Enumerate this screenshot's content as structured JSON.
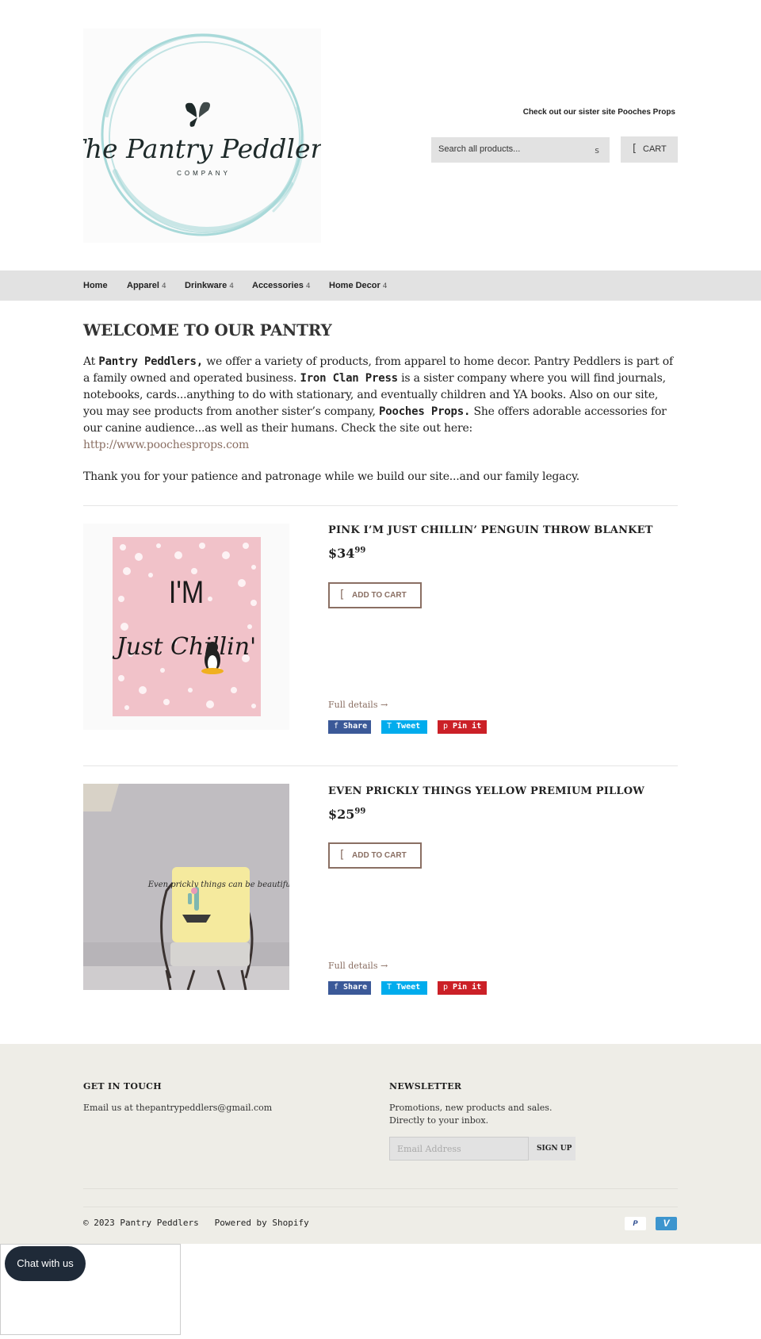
{
  "header": {
    "logo_text": "The Pantry Peddlers",
    "logo_subtext": "COMPANY",
    "sister_link": "Check out our sister site Pooches Props",
    "search_placeholder": "Search all products...",
    "search_icon_glyph": "s",
    "cart_icon_glyph": "[",
    "cart_label": "CART"
  },
  "nav": {
    "items": [
      {
        "label": "Home"
      },
      {
        "label": "Apparel",
        "caret": "4"
      },
      {
        "label": "Drinkware",
        "caret": "4"
      },
      {
        "label": "Accessories",
        "caret": "4"
      },
      {
        "label": "Home Decor",
        "caret": "4"
      }
    ]
  },
  "welcome": {
    "title": "WELCOME TO OUR PANTRY",
    "p1_a": "At ",
    "p1_b": "Pantry Peddlers,",
    "p1_c": "  we offer a variety of products, from apparel to home decor. Pantry Peddlers is part of a family owned and operated business. ",
    "p1_d": "Iron Clan Press",
    "p1_e": "  is a sister company where you will find journals, notebooks, cards...anything to do with stationary, and eventually children and YA books. Also on our site, you may see products from another sister’s company, ",
    "p1_f": "Pooches Props.",
    "p1_g": "  She  offers adorable accessories for our canine audience...as well as their humans. Check the site out here: ",
    "p1_link": "http://www.poochesprops.com",
    "thanks": "Thank you for your patience and patronage while we build our site...and our family legacy."
  },
  "products": [
    {
      "title": "PINK I’M JUST CHILLIN’ PENGUIN THROW BLANKET",
      "price_main": "$34",
      "price_cents": "99",
      "image_text_1": "I'M",
      "image_text_2": "Just Chillin'",
      "add_to_cart": "ADD TO CART",
      "full_details": "Full details →"
    },
    {
      "title": "EVEN PRICKLY THINGS YELLOW PREMIUM PILLOW",
      "price_main": "$25",
      "price_cents": "99",
      "image_text_1": "Even prickly things can be beautiful.",
      "add_to_cart": "ADD TO CART",
      "full_details": "Full details →"
    }
  ],
  "social": {
    "share_icon": "f",
    "share": "Share",
    "tweet_icon": "T",
    "tweet": "Tweet",
    "pin_icon": "p",
    "pin": "Pin it"
  },
  "footer": {
    "contact_heading": "GET IN TOUCH",
    "contact_text": "Email us at thepantrypeddlers@gmail.com",
    "newsletter_heading": "NEWSLETTER",
    "newsletter_text_1": "Promotions, new products and sales.",
    "newsletter_text_2": "Directly to your inbox.",
    "email_placeholder": "Email Address",
    "signup": "SIGN UP",
    "copyright": "© 2023 Pantry Peddlers",
    "powered": "Powered by Shopify",
    "payment_paypal": "P",
    "payment_venmo": "V"
  },
  "chat": {
    "label": "Chat with us"
  },
  "colors": {
    "accent": "#8a6f63",
    "nav_bg": "#e2e2e2",
    "footer_bg": "#eeede7",
    "share": "#3b5998",
    "tweet": "#00aced",
    "pin": "#cb2027",
    "logo_ring": "#a8d9d9"
  }
}
